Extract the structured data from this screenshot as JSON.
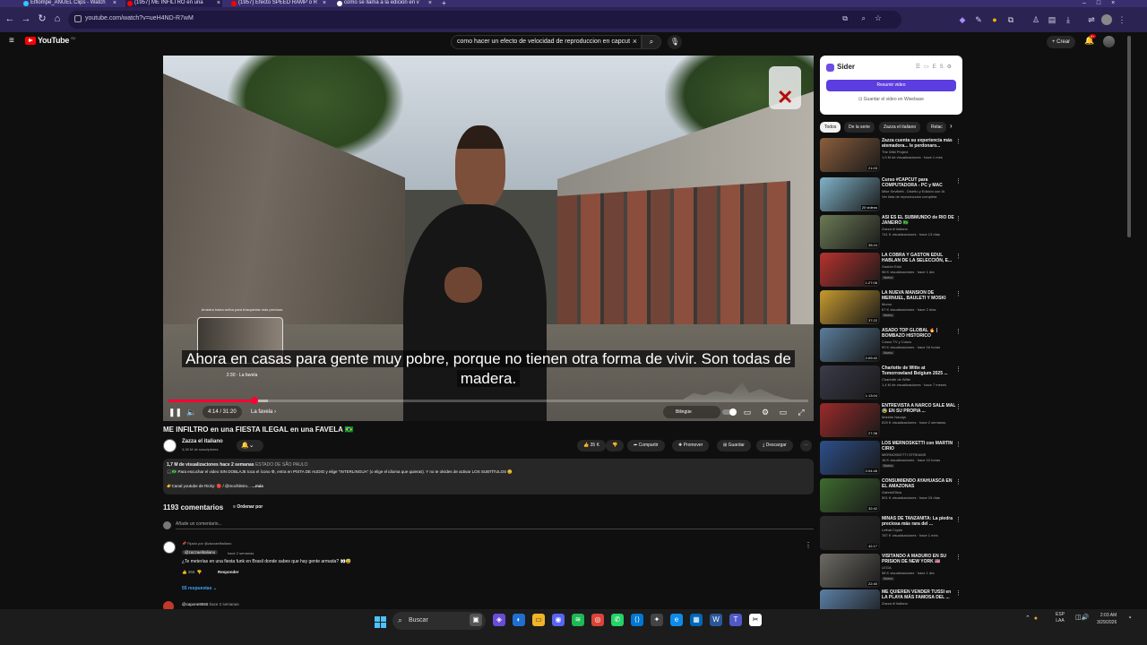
{
  "browser": {
    "tabs": [
      {
        "title": "Elflompe_ANUEL Clips - Watch",
        "color": "#31c7ff"
      },
      {
        "title": "(1957) ME INFILTRO en una",
        "color": "#ff0000"
      },
      {
        "title": "(1957) Efecto SPEED RAMP o R",
        "color": "#ff0000"
      },
      {
        "title": "como se llama a la edicion en v",
        "color": "#ffffff"
      }
    ],
    "url": "youtube.com/watch?v=ueH4ND-R7wM"
  },
  "masthead": {
    "logo_text": "YouTube",
    "logo_country": "SV",
    "search_query": "como hacer un efecto de velocidad de reproduccion en capcut",
    "create_label": "Crear",
    "notifications_count": "9+"
  },
  "player": {
    "subtitle": "Ahora en casas para gente muy pobre, porque no tienen otra forma de vivir. Son todas de madera.",
    "preview_tip": "Arrastra hacia arriba para búsquedas más precisas",
    "preview_time": "2:30 · La favela",
    "time": "4:14 / 31:20",
    "chapter": "La favela ›",
    "audio_label": "Bilingüe",
    "progress": 0.135,
    "buffered": 0.155
  },
  "video": {
    "title": "ME INFILTRO en una FIESTA ILEGAL en una FAVELA 🇧🇷",
    "channel": "Zazza el italiano",
    "subscribers": "3,28 M de suscriptores",
    "likes": "35 K",
    "share_label": "Compartir",
    "promote_label": "Promover",
    "save_label": "Guardar",
    "download_label": "Descargar",
    "views": "1,7 M de visualizaciones",
    "age": "hace 2 semanas",
    "location": "ESTADO DE SÃO PAULO",
    "description": "🎧🇧🇷 Para escuchar el video SIN DOBLAJE toca el ícono ⚙, entra en PISTA DE AUDIO y elige \"INTERLINGUA\" (o elige el idioma que quieras). Y no te olvides de activar LOS SUBTÍTULOS 😊",
    "description_line2": "👉Canal youtube de Ricky: 🔴 / @mochileiro...",
    "more_label": "...más"
  },
  "comments": {
    "count": "1193 comentarios",
    "sort_label": "Ordenar por",
    "add_placeholder": "Añade un comentario...",
    "pinned_by": "Fijado por @zazzaelitaliano",
    "author": "@zazzaelitaliano",
    "time": "hace 2 semanas",
    "text": "¿Te meterías en una fiesta funk en Brasil donde sabes que hay gente armada? 👀😅",
    "likes": "366",
    "reply_label": "Responder",
    "replies": "55 respuestas",
    "next_author": "@capone8655",
    "next_time": "hace 2 semanas"
  },
  "sider": {
    "name": "Sider",
    "summarize_label": "Resumir video",
    "save_label": "Guardar el video en Wisebase"
  },
  "chips": [
    "Todos",
    "De la serie",
    "Zazza el italiano",
    "Relac"
  ],
  "recommendations": [
    {
      "title": "Zazza cuenta su experiencia más atemadora... le perdonaro...",
      "channel": "The Wild Project",
      "meta": "1,5 M de visualizaciones · hace 1 mes",
      "duration": "21:03",
      "badge": "",
      "color": "#8b5e3c"
    },
    {
      "title": "Curso #CAPCUT para COMPUTADORA - PC y MAC",
      "channel": "Mike Sevilletti - Diseño y Edición con IA",
      "meta": "Ver lista de reproducción completa",
      "duration": "20 videos",
      "badge": "",
      "color": "#7fb3c8"
    },
    {
      "title": "ASÍ ES EL SUBMUNDO de RIO DE JANEIRO 🇧🇷",
      "channel": "Zazza el italiano",
      "meta": "741 K visualizaciones · hace 13 días",
      "duration": "35:24",
      "badge": "",
      "color": "#6b7a55"
    },
    {
      "title": "LA COBRA Y GASTÓN EDUL HABLAN DE LA SELECCIÓN, E...",
      "channel": "Gastón Edul",
      "meta": "98 K visualizaciones · hace 1 día",
      "duration": "1:27:06",
      "badge": "Nuevo",
      "color": "#b5332e"
    },
    {
      "title": "LA NUEVA MANSIÓN DE MERNUEL, BAULETI Y MOSKI",
      "channel": "Momo",
      "meta": "67 K visualizaciones · hace 2 días",
      "duration": "37:22",
      "badge": "Nuevo",
      "color": "#c79a2f"
    },
    {
      "title": "ASADO TOP GLOBAL 🔥 | BOMBAZO HISTORICO",
      "channel": "Coscu TV y Coscu",
      "meta": "90 K visualizaciones · hace 16 horas",
      "duration": "2:09:42",
      "badge": "Nuevo",
      "color": "#5a7d9a"
    },
    {
      "title": "Charlotte de Witte at Tomorrowland Belgium 2025 ...",
      "channel": "Charlotte de Witte",
      "meta": "1,4 M de visualizaciones · hace 7 meses",
      "duration": "1:13:04",
      "badge": "",
      "color": "#3a3a4a"
    },
    {
      "title": "ENTREVISTA A NARCO SALE MAL 😰 EN SU PROPIA ...",
      "channel": "Markito Navaja",
      "meta": "815 K visualizaciones · hace 2 semanas",
      "duration": "27:38",
      "badge": "",
      "color": "#9b2a2a"
    },
    {
      "title": "LOS MERNOSKETTI con MARTIN CIRIO",
      "channel": "MERNOSKETTI STREAMS",
      "meta": "16 K visualizaciones · hace 10 horas",
      "duration": "2:04:46",
      "badge": "Nuevo",
      "color": "#2d4f8a"
    },
    {
      "title": "CONSUMIENDO AYAHUASCA EN EL AMAZONAS",
      "channel": "GabrielOliva",
      "meta": "501 K visualizaciones · hace 15 días",
      "duration": "32:42",
      "badge": "",
      "color": "#3e6b2f"
    },
    {
      "title": "MINAS DE TANZANITA: La piedra preciosa más rara del ...",
      "channel": "Lethal Crysis",
      "meta": "787 K visualizaciones · hace 1 mes",
      "duration": "42:17",
      "badge": "",
      "color": "#2b2b2b"
    },
    {
      "title": "VISITANDO A MADURO EN SU PRISION DE NEW YORK 🇺🇸",
      "channel": "LEGA",
      "meta": "58 K visualizaciones · hace 1 día",
      "duration": "22:40",
      "badge": "Nuevo",
      "color": "#6d6a63"
    },
    {
      "title": "ME QUIEREN VENDER TUSSI en LA PLAYA MÁS FAMOSA DEL ...",
      "channel": "Zazza el italiano",
      "meta": "",
      "duration": "",
      "badge": "",
      "color": "#5b7fa5"
    }
  ],
  "taskbar": {
    "search_label": "Buscar",
    "lang_line1": "ESP",
    "lang_line2": "LAA",
    "time": "2:03 AM",
    "date": "3/29/2026"
  }
}
